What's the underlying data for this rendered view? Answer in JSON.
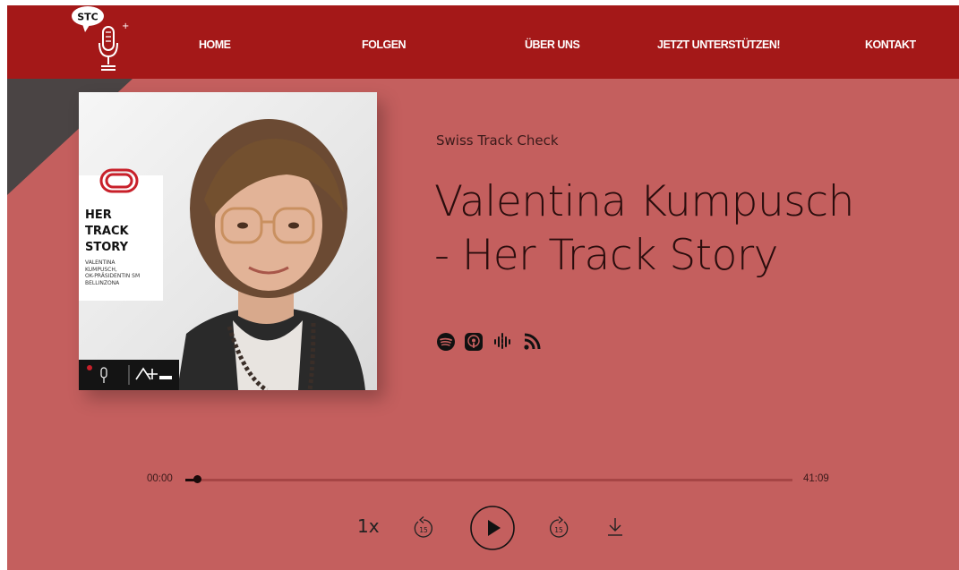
{
  "header": {
    "logo_text": "STC",
    "nav": [
      "HOME",
      "FOLGEN",
      "ÜBER UNS",
      "JETZT UNTERSTÜTZEN!",
      "KONTAKT"
    ]
  },
  "cover": {
    "title_lines": [
      "HER",
      "TRACK",
      "STORY"
    ],
    "subtitle_lines": [
      "VALENTINA",
      "KUMPUSCH,",
      "OK-PRÄSIDENTIN SM",
      "BELLINZONA"
    ]
  },
  "episode": {
    "podcast_name": "Swiss Track Check",
    "title_lines": [
      "Valentina Kumpusch",
      "- Her Track Story"
    ]
  },
  "platforms": [
    {
      "name": "spotify-icon"
    },
    {
      "name": "apple-podcasts-icon"
    },
    {
      "name": "google-podcasts-icon"
    },
    {
      "name": "rss-icon"
    }
  ],
  "player": {
    "current_time": "00:00",
    "duration": "41:09",
    "progress": 0.02,
    "speed": "1x",
    "rewind_seconds": "15",
    "forward_seconds": "15"
  },
  "colors": {
    "header_bg": "#a41818",
    "page_bg": "#c45f5e"
  }
}
